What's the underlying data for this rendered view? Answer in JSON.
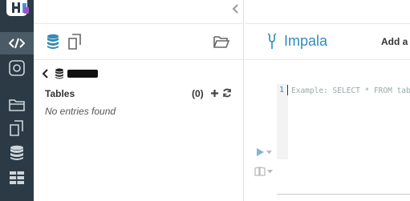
{
  "app": {
    "rail": {
      "items": [
        {
          "icon": "editor-code-icon",
          "active": true
        },
        {
          "icon": "target-icon",
          "active": false
        },
        {
          "icon": "folder-icon",
          "active": false
        },
        {
          "icon": "documents-icon",
          "active": false
        },
        {
          "icon": "database-icon",
          "active": false
        },
        {
          "icon": "table-icon",
          "active": false
        }
      ]
    }
  },
  "assist": {
    "header_icons": [
      "database-icon",
      "documents-icon",
      "folder-open-icon"
    ],
    "tables_title": "Tables",
    "tables_count": "(0)",
    "empty_text": "No entries found"
  },
  "editor": {
    "engine_label": "Impala",
    "add_label": "Add a",
    "line_number": "1",
    "placeholder": "Example: SELECT * FROM tablename, or press CTRL + space"
  },
  "colors": {
    "rail_bg": "#2b3a45",
    "accent": "#338bb8"
  }
}
